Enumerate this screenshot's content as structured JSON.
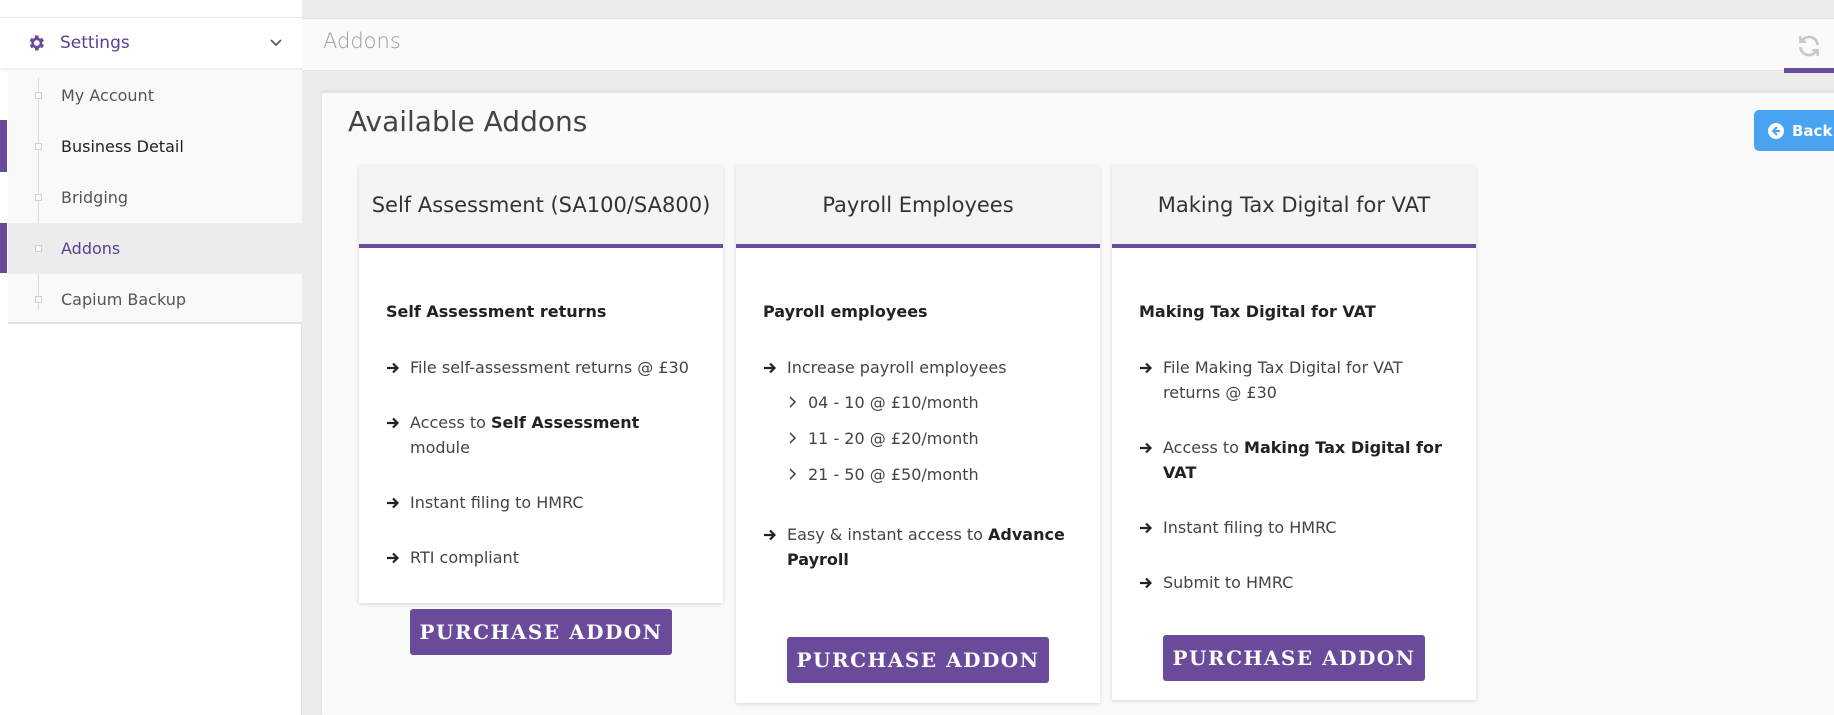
{
  "sidebar": {
    "settings_label": "Settings",
    "items": [
      {
        "label": "My Account"
      },
      {
        "label": "Business Detail"
      },
      {
        "label": "Bridging"
      },
      {
        "label": "Addons"
      },
      {
        "label": "Capium Backup"
      }
    ]
  },
  "header": {
    "title": "Addons"
  },
  "main": {
    "heading": "Available Addons",
    "back_label": "Back",
    "cards": [
      {
        "title": "Self Assessment (SA100/SA800)",
        "subtitle": "Self Assessment returns",
        "features": [
          {
            "text": "File self-assessment returns @ £30"
          },
          {
            "prefix": "Access to ",
            "bold": "Self Assessment",
            "suffix": " module"
          },
          {
            "text": "Instant filing to HMRC"
          },
          {
            "text": "RTI compliant"
          }
        ],
        "button": "PURCHASE ADDON"
      },
      {
        "title": "Payroll Employees",
        "subtitle": "Payroll employees",
        "features": [
          {
            "text": "Increase payroll employees"
          },
          {
            "prefix": "Easy & instant access to ",
            "bold": "Advance Payroll",
            "suffix": ""
          }
        ],
        "tiers": [
          "04 - 10 @ £10/month",
          "11 - 20 @ £20/month",
          "21 - 50 @ £50/month"
        ],
        "button": "PURCHASE ADDON"
      },
      {
        "title": "Making Tax Digital for VAT",
        "subtitle": "Making Tax Digital for VAT",
        "features": [
          {
            "text": "File Making Tax Digital for VAT returns @ £30"
          },
          {
            "prefix": "Access to ",
            "bold": "Making Tax Digital for VAT",
            "suffix": ""
          },
          {
            "text": "Instant filing to HMRC"
          },
          {
            "text": "Submit to HMRC"
          }
        ],
        "button": "PURCHASE ADDON"
      }
    ]
  },
  "colors": {
    "accent": "#6a4a9a",
    "back_button": "#4aa3f0"
  },
  "icons": {
    "settings": "gear-icon",
    "expand": "chevron-down-icon",
    "refresh": "refresh-icon",
    "back": "circle-arrow-left-icon",
    "feature": "arrow-right-icon",
    "tier": "chevron-right-icon"
  }
}
